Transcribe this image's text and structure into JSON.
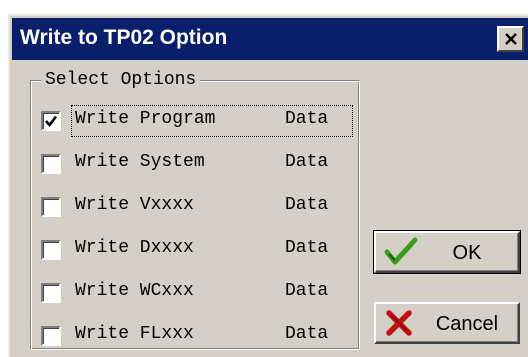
{
  "dialog": {
    "title": "Write to TP02 Option"
  },
  "group": {
    "legend": "Select Options"
  },
  "options": [
    {
      "label": "Write Program",
      "suffix": "Data",
      "checked": true
    },
    {
      "label": "Write System",
      "suffix": "Data",
      "checked": false
    },
    {
      "label": "Write Vxxxx",
      "suffix": "Data",
      "checked": false
    },
    {
      "label": "Write Dxxxx",
      "suffix": "Data",
      "checked": false
    },
    {
      "label": "Write WCxxx",
      "suffix": "Data",
      "checked": false
    },
    {
      "label": "Write FLxxx",
      "suffix": "Data",
      "checked": false
    }
  ],
  "buttons": {
    "ok_label": "OK",
    "cancel_label": "Cancel"
  },
  "colors": {
    "titlebar": "#0a1f6b",
    "face": "#d4d0c8",
    "ok_icon": "#3a9a1a",
    "cancel_icon": "#c01010"
  },
  "icons": {
    "close": "close-icon",
    "ok": "checkmark-icon",
    "cancel": "cross-icon"
  }
}
